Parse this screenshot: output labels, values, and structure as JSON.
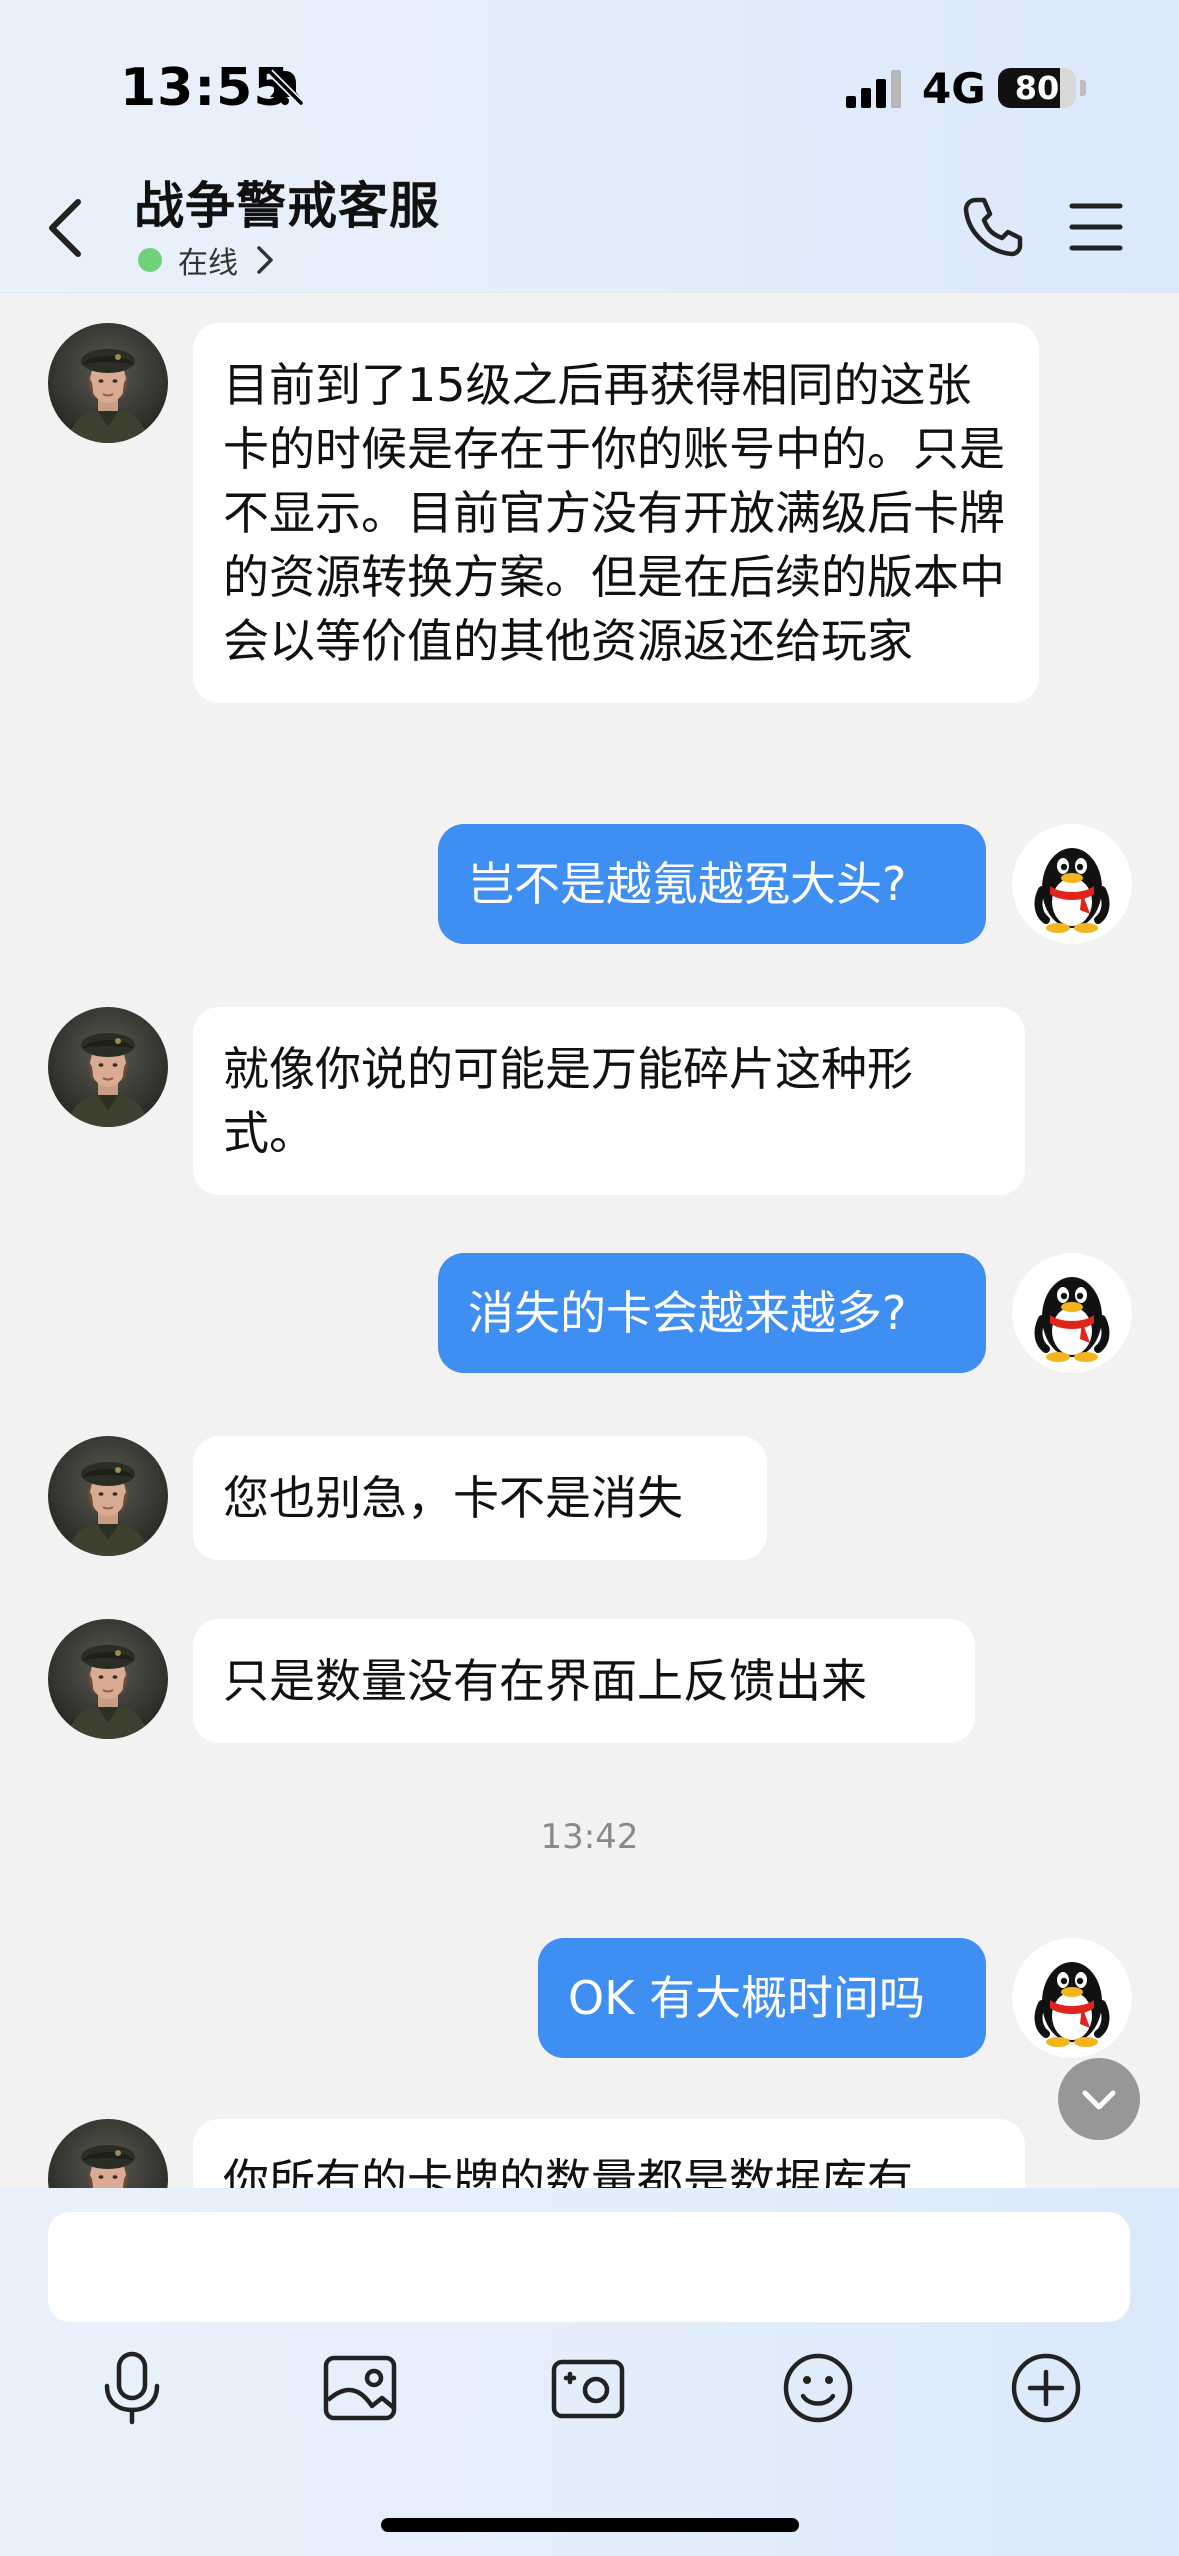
{
  "status_bar": {
    "time": "13:55",
    "network": "4G",
    "battery": "80",
    "battery_level": 0.8
  },
  "header": {
    "title": "战争警戒客服",
    "presence": "在线"
  },
  "messages": [
    {
      "sender": "agent",
      "text": "目前到了15级之后再获得相同的这张卡的时候是存在于你的账号中的。只是不显示。目前官方没有开放满级后卡牌的资源转换方案。但是在后续的版本中会以等价值的其他资源返还给玩家"
    },
    {
      "sender": "user",
      "text": "岂不是越氪越冤大头?"
    },
    {
      "sender": "agent",
      "text": "就像你说的可能是万能碎片这种形式。"
    },
    {
      "sender": "user",
      "text": "消失的卡会越来越多?"
    },
    {
      "sender": "agent",
      "text": "您也别急，卡不是消失"
    },
    {
      "sender": "agent",
      "text": "只是数量没有在界面上反馈出来"
    },
    {
      "sender": "user",
      "text": "OK 有大概时间吗"
    },
    {
      "sender": "agent",
      "text": "你所有的卡牌的数量都是数据库有"
    }
  ],
  "timestamp": "13:42",
  "input": {
    "value": "",
    "placeholder": ""
  },
  "toolbar": {
    "icons": [
      "microphone-icon",
      "image-icon",
      "camera-icon",
      "emoji-icon",
      "plus-icon"
    ]
  },
  "colors": {
    "outgoing_bubble": "#3f8ef2",
    "incoming_bubble": "#ffffff",
    "online_dot": "#6fd17c",
    "header_bg": "#e6effb"
  }
}
